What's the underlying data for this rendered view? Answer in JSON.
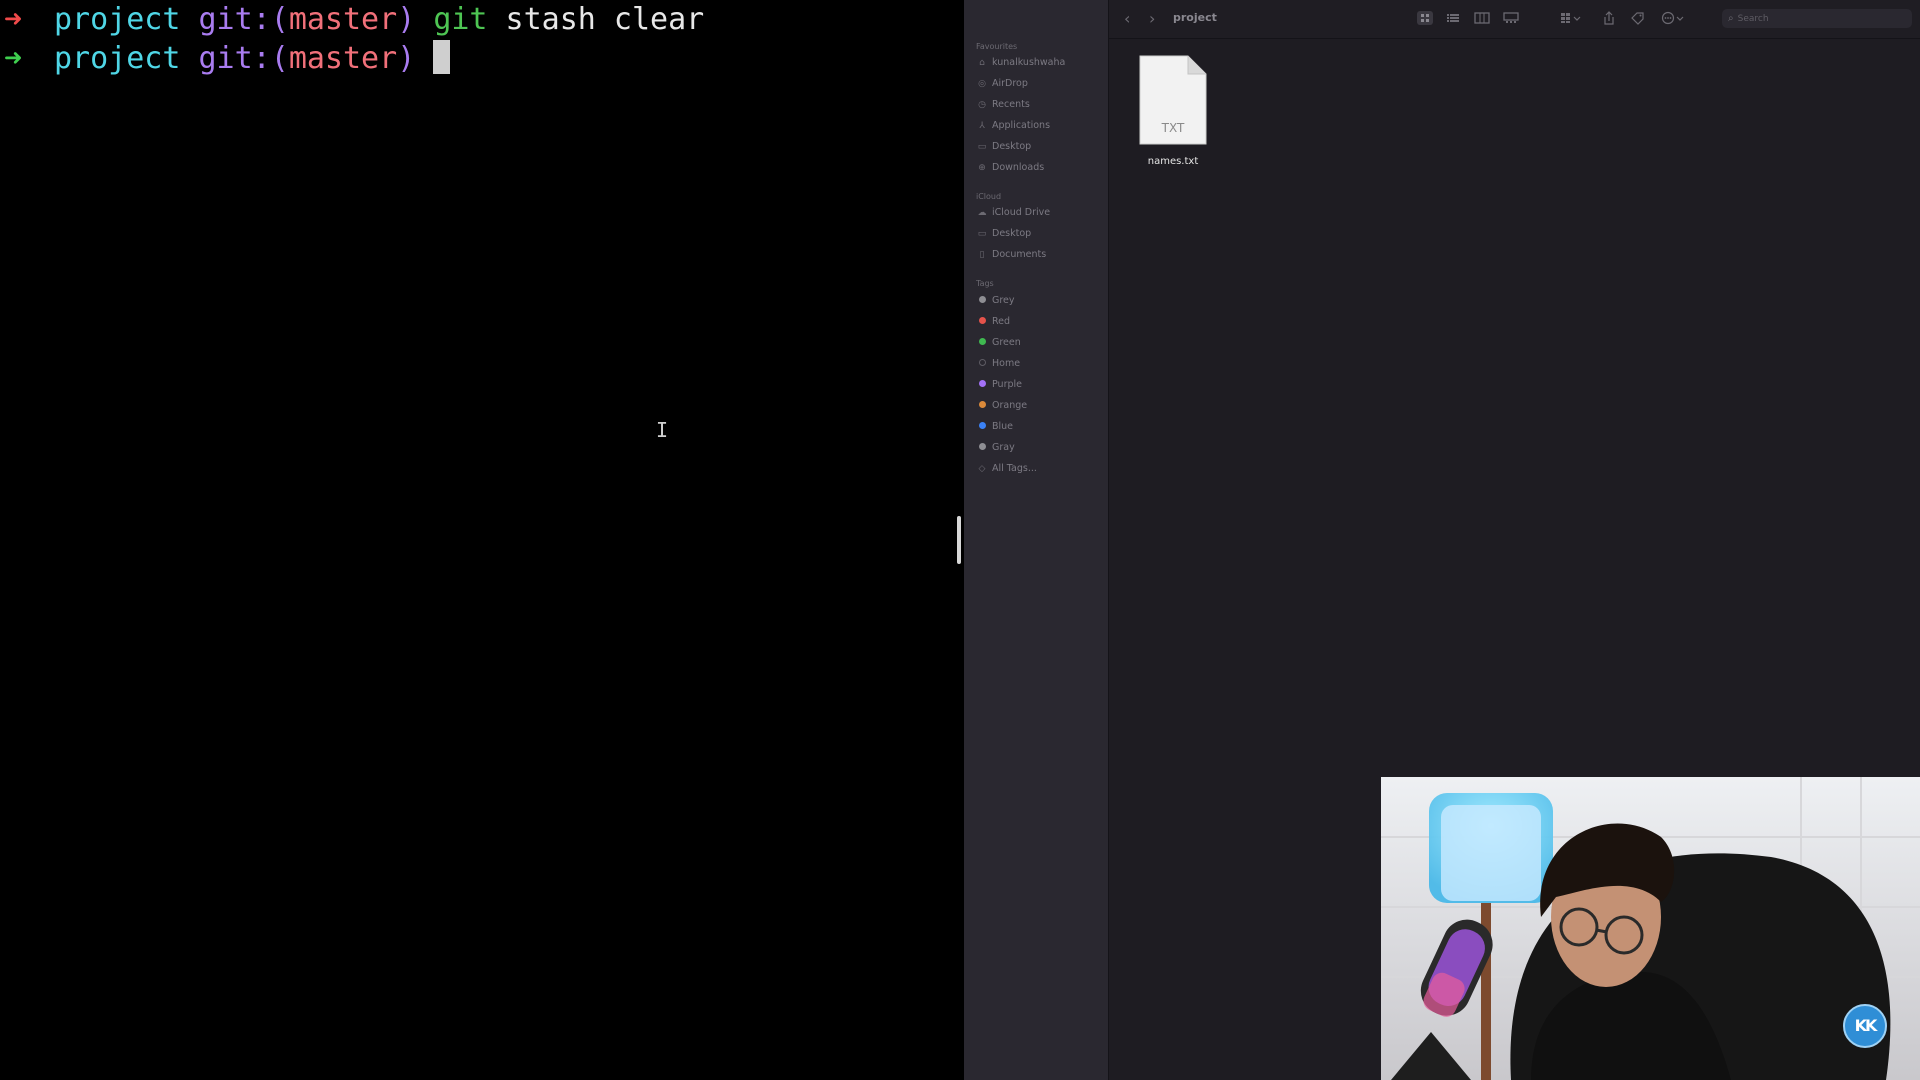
{
  "terminal": {
    "lines": [
      {
        "arrow": "➜",
        "dir": "project",
        "git": "git:(",
        "branch": "master",
        "git_close": ")",
        "cmd": "git",
        "args": " stash clear"
      },
      {
        "arrow": "➜",
        "dir": "project",
        "git": "git:(",
        "branch": "master",
        "git_close": ")"
      }
    ],
    "ibeam": "I"
  },
  "finder": {
    "title": "project",
    "search_placeholder": "Search",
    "nav_back": "‹",
    "nav_forward": "›",
    "sidebar": {
      "favourites_label": "Favourites",
      "favourites": [
        {
          "label": "kunalkushwaha",
          "icon": "home-icon",
          "glyph": "⌂"
        },
        {
          "label": "AirDrop",
          "icon": "airdrop-icon",
          "glyph": "◎"
        },
        {
          "label": "Recents",
          "icon": "clock-icon",
          "glyph": "◷"
        },
        {
          "label": "Applications",
          "icon": "applications-icon",
          "glyph": "⅄"
        },
        {
          "label": "Desktop",
          "icon": "desktop-icon",
          "glyph": "▭"
        },
        {
          "label": "Downloads",
          "icon": "downloads-icon",
          "glyph": "⊕"
        }
      ],
      "icloud_label": "iCloud",
      "icloud": [
        {
          "label": "iCloud Drive",
          "icon": "cloud-icon",
          "glyph": "☁"
        },
        {
          "label": "Desktop",
          "icon": "desktop-icon",
          "glyph": "▭"
        },
        {
          "label": "Documents",
          "icon": "document-icon",
          "glyph": "▯"
        }
      ],
      "tags_label": "Tags",
      "tags": [
        {
          "label": "Grey",
          "color": "#8e8e93"
        },
        {
          "label": "Red",
          "color": "#e5534b"
        },
        {
          "label": "Green",
          "color": "#3fb950"
        },
        {
          "label": "Home",
          "color": "#2a2830"
        },
        {
          "label": "Purple",
          "color": "#a371f7"
        },
        {
          "label": "Orange",
          "color": "#db8a3a"
        },
        {
          "label": "Blue",
          "color": "#3b82f6"
        },
        {
          "label": "Gray",
          "color": "#8e8e93"
        }
      ],
      "all_tags": "All Tags..."
    },
    "file": {
      "name": "names.txt",
      "type_label": "TXT"
    }
  },
  "overlay": {
    "logo_text": "KK"
  }
}
